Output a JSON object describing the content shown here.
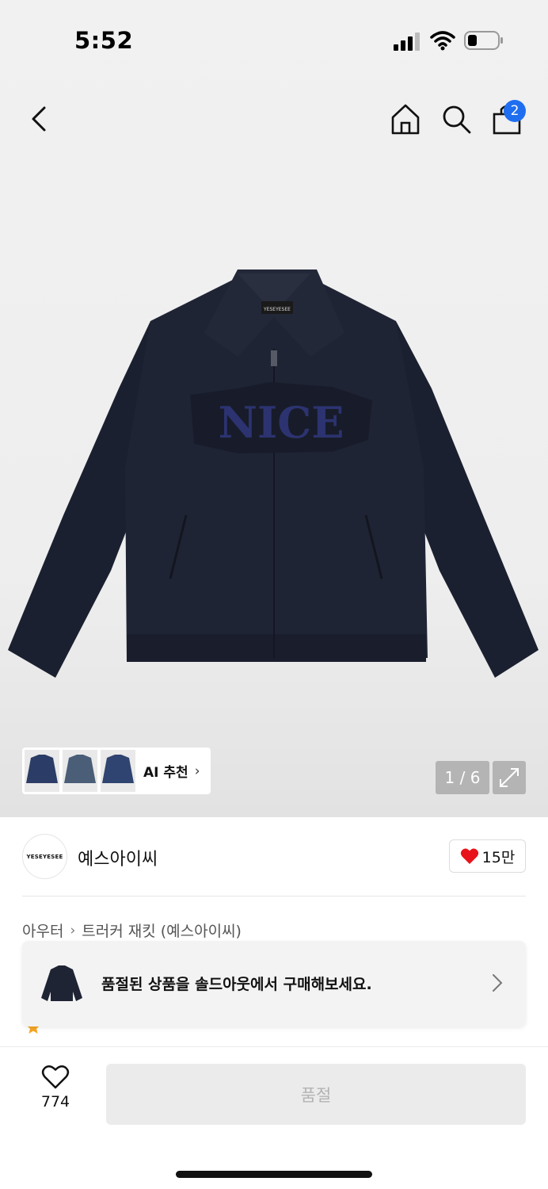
{
  "status": {
    "time": "5:52"
  },
  "nav": {
    "cart_count": "2"
  },
  "gallery": {
    "ai_label": "AI 추천",
    "ai_chevron": "›",
    "counter": "1 / 6"
  },
  "brand": {
    "logo_text": "YESEYESEE",
    "name": "예스아이씨",
    "likes": "15만"
  },
  "breadcrumb": {
    "category": "아우터",
    "product": "트러커 재킷 (예스아이씨)"
  },
  "sold_out_banner": {
    "message": "품절된 상품을 솔드아웃에서 구매해보세요."
  },
  "bottom": {
    "wish_count": "774",
    "buy_label": "품절"
  },
  "colors": {
    "accent_blue": "#1f6ef0",
    "heart_red": "#e8131a",
    "jacket_navy": "#1e2231"
  }
}
